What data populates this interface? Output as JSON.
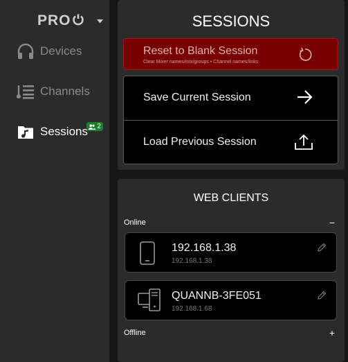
{
  "sidebar": {
    "logo": "PRO",
    "items": [
      {
        "label": "Devices",
        "icon": "headphones-icon",
        "active": false
      },
      {
        "label": "Channels",
        "icon": "channels-icon",
        "active": false
      },
      {
        "label": "Sessions",
        "icon": "sessions-folder-icon",
        "active": true,
        "badge": "2"
      }
    ]
  },
  "sessions": {
    "title": "SESSIONS",
    "reset": {
      "label": "Reset to Blank Session",
      "sublabel": "Clear Mixer names/mix/groups • Channel names/links"
    },
    "save": {
      "label": "Save Current Session"
    },
    "load": {
      "label": "Load Previous Session"
    }
  },
  "web_clients": {
    "title": "WEB CLIENTS",
    "online_label": "Online",
    "offline_label": "Offline",
    "online_toggle": "−",
    "offline_toggle": "+",
    "clients": [
      {
        "name": "192.168.1.38",
        "ip": "192.168.1.38",
        "device": "phone-icon"
      },
      {
        "name": "QUANNB-3FE051",
        "ip": "192.168.1.68",
        "device": "desktop-icon"
      }
    ]
  },
  "colors": {
    "danger": "#7a0000",
    "badge": "#1f7d2c",
    "panel": "#2b2b2b",
    "background": "#161616"
  }
}
